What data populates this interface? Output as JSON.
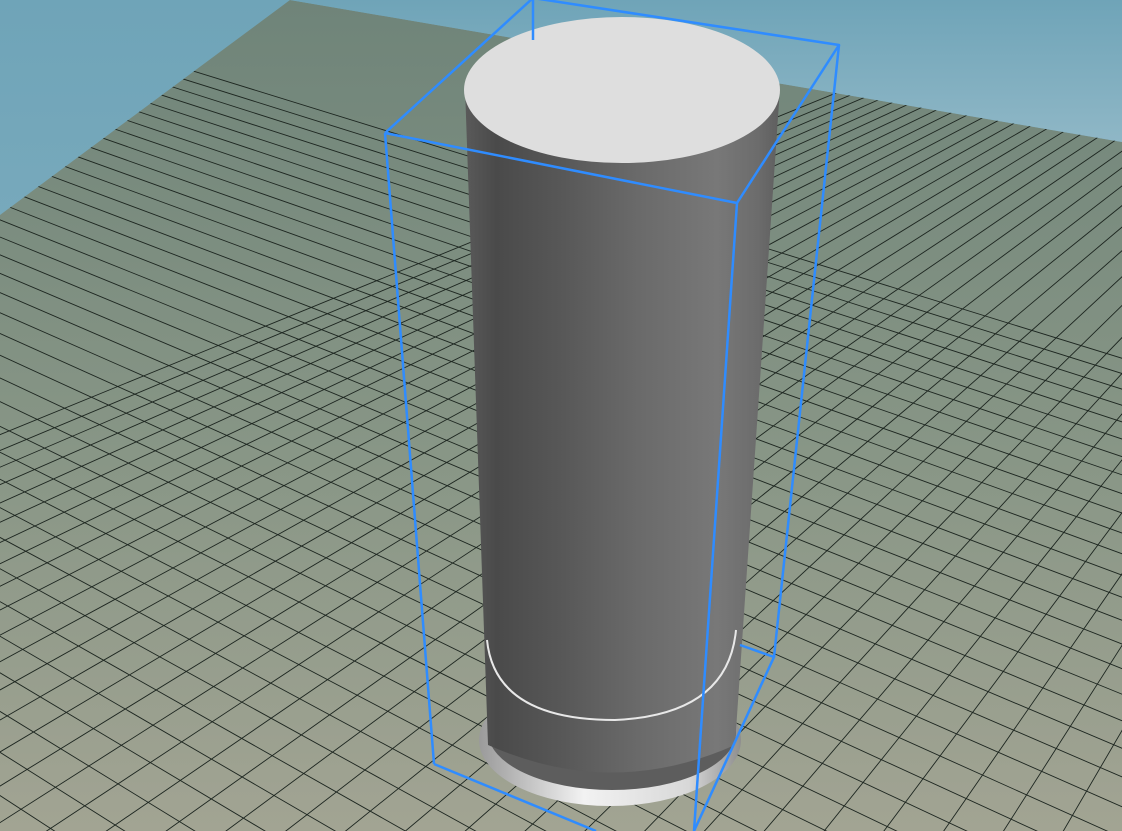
{
  "viewport": {
    "kind": "3d-modeling-viewport",
    "colors": {
      "sky_top": "#6fa4b8",
      "sky_bottom": "#8fb7c6",
      "ground_far": "#6f8479",
      "ground_near": "#a2a493",
      "grid_line": "#1d2620",
      "cylinder_dark": "#4a4a4a",
      "cylinder_light": "#7a7a7a",
      "cylinder_top": "#dedede",
      "rim_highlight": "#e8e8e8",
      "selection_box": "#2f8cff"
    },
    "objects": [
      {
        "name": "cylinder",
        "selected": true,
        "icon": "cylinder-icon"
      }
    ],
    "grid": {
      "visible": true
    },
    "selection": {
      "visible": true,
      "style": "bounding-box"
    }
  }
}
